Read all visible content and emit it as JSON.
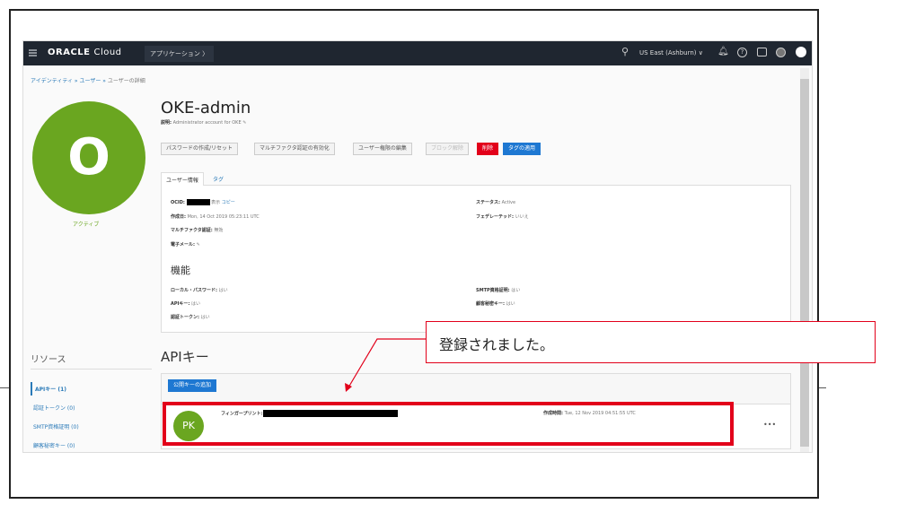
{
  "nav": {
    "brand": "ORACLE",
    "brand2": "Cloud",
    "apps": "アプリケーション 〉",
    "region": "US East (Ashburn) ∨"
  },
  "breadcrumb": {
    "a": "アイデンティティ",
    "b": "ユーザー",
    "c": "ユーザーの詳細",
    "sep": " » "
  },
  "user": {
    "initial": "O",
    "status": "アクティブ",
    "name": "OKE-admin",
    "desc_label": "説明:",
    "desc": "Administrator account for OKE"
  },
  "actions": [
    "パスワードの作成/リセット",
    "マルチファクタ認証の有効化",
    "ユーザー権限の編集",
    "ブロック解除",
    "削除",
    "タグの適用"
  ],
  "tabs": [
    "ユーザー情報",
    "タグ"
  ],
  "info": {
    "ocid_label": "OCID:",
    "show": "表示",
    "copy": "コピー",
    "created_label": "作成日:",
    "created": "Mon, 14 Oct 2019 05:23:11 UTC",
    "mfa_label": "マルチファクタ認証:",
    "mfa": "無効",
    "email_label": "電子メール:",
    "status_label": "ステータス:",
    "status": "Active",
    "fed_label": "フェデレーテッド:",
    "fed": "いいえ"
  },
  "capabilities": {
    "title": "機能",
    "items": [
      {
        "label": "ローカル・パスワード:",
        "value": "はい"
      },
      {
        "label": "APIキー:",
        "value": "はい"
      },
      {
        "label": "認証トークン:",
        "value": "はい"
      },
      {
        "label": "SMTP資格証明:",
        "value": "はい"
      },
      {
        "label": "顧客秘密キー:",
        "value": "はい"
      }
    ]
  },
  "resources": {
    "title": "リソース",
    "items": [
      "APIキー (1)",
      "認証トークン (0)",
      "SMTP資格証明 (0)",
      "顧客秘密キー (0)"
    ]
  },
  "apikeys": {
    "title": "APIキー",
    "add": "公開キーの追加",
    "initials": "PK",
    "fp_label": "フィンガープリント:",
    "created_label": "作成時間:",
    "created": "Tue, 12 Nov 2019 04:51:55 UTC",
    "menu": "•••"
  },
  "callout": {
    "text": "登録されました。"
  },
  "colors": {
    "nav": "#1f2630",
    "green": "#6aa620",
    "red": "#e2001a",
    "blue": "#1e78d2"
  }
}
